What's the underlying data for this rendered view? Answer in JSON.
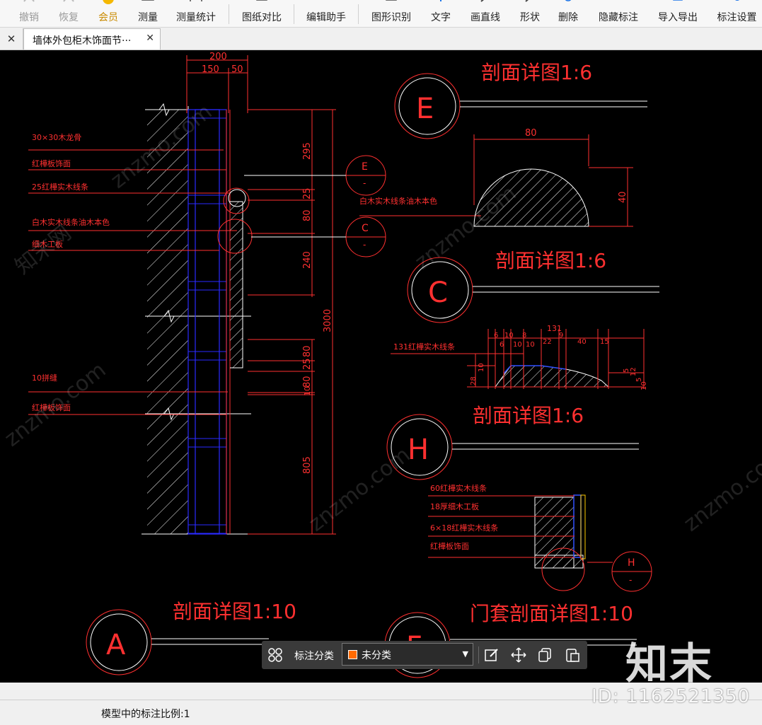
{
  "toolbar": {
    "buttons": [
      {
        "label": "撤销",
        "state": "disabled",
        "icon": "undo-icon"
      },
      {
        "label": "恢复",
        "state": "disabled",
        "icon": "redo-icon"
      },
      {
        "label": "会员",
        "state": "vip",
        "icon": "vip-icon"
      },
      {
        "label": "测量",
        "state": "normal",
        "icon": "measure-icon"
      },
      {
        "label": "测量统计",
        "state": "normal",
        "icon": "measure-stats-icon"
      },
      {
        "label": "图纸对比",
        "state": "normal",
        "icon": "compare-icon"
      },
      {
        "label": "编辑助手",
        "state": "normal",
        "icon": "edit-assistant-icon"
      },
      {
        "label": "图形识别",
        "state": "normal",
        "icon": "shape-recognition-icon"
      },
      {
        "label": "文字",
        "state": "normal",
        "icon": "text-icon"
      },
      {
        "label": "画直线",
        "state": "normal",
        "icon": "line-icon"
      },
      {
        "label": "形状",
        "state": "normal",
        "icon": "shape-icon"
      },
      {
        "label": "删除",
        "state": "normal",
        "icon": "delete-icon"
      },
      {
        "label": "隐藏标注",
        "state": "normal",
        "icon": "hide-annotation-icon"
      },
      {
        "label": "导入导出",
        "state": "normal",
        "icon": "import-export-icon"
      },
      {
        "label": "标注设置",
        "state": "normal",
        "icon": "annotation-settings-icon"
      }
    ]
  },
  "tabs": {
    "close_all": "✕",
    "active_tab_title": "墙体外包柜木饰面节···",
    "tab_close": "✕"
  },
  "drawing": {
    "titles": {
      "e": "剖面详图1:6",
      "c": "剖面详图1:6",
      "h": "剖面详图1:6",
      "a": "剖面详图1:10",
      "f": "门套剖面详图1:10"
    },
    "callouts": {
      "e_big": "E",
      "c_big": "C",
      "h_big": "H",
      "a_big": "A",
      "f_big": "F",
      "e_small": "E",
      "c_small": "C",
      "h_small": "H",
      "dash": "-"
    },
    "left_labels": [
      "30×30木龙骨",
      "红樺板饰面",
      "25红樺实木线条",
      "白木实木线条油木本色",
      "细木工板",
      "10拼缝",
      "红樺板饰面"
    ],
    "mid_label": "白木实木线条油木本色",
    "c_label": "131红樺实木线条",
    "h_labels": [
      "60红樺实木线条",
      "18厚细木工板",
      "6×18红樺实木线条",
      "红樺板饰面"
    ],
    "dims_top": [
      "200",
      "150",
      "50"
    ],
    "dims_vertical": [
      "295",
      "25",
      "80",
      "240",
      "3000",
      "80",
      "25",
      "80",
      "10",
      "805"
    ],
    "dim_e_width": "80",
    "dim_e_height": "40",
    "dims_c": [
      "131",
      "6",
      "10",
      "8",
      "9",
      "22",
      "40",
      "15",
      "6",
      "10",
      "10",
      "28",
      "10",
      "5",
      "12",
      "5",
      "10"
    ]
  },
  "floatbar": {
    "category_label": "标注分类",
    "category_value": "未分类",
    "swatch_color": "#ff6a00"
  },
  "watermarks": {
    "site": "znzmo.com",
    "brand": "知末网",
    "big": "知末",
    "id": "ID: 1162521350"
  },
  "status": {
    "scale_text": "模型中的标注比例:1"
  }
}
